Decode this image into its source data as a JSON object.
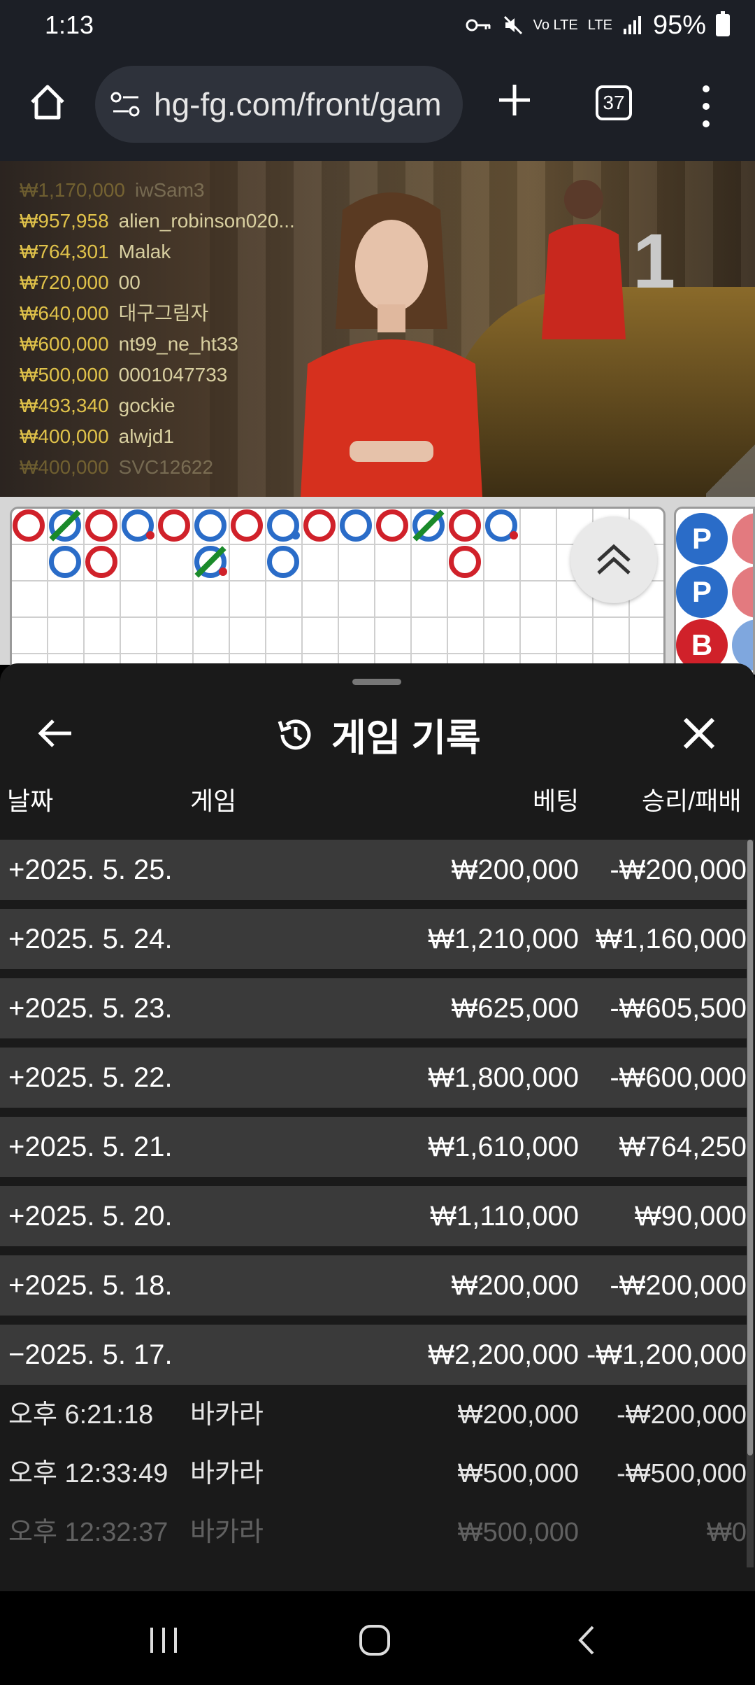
{
  "status_bar": {
    "time": "1:13",
    "network": "LTE",
    "volte": "Vo LTE",
    "battery": "95%"
  },
  "browser": {
    "url": "hg-fg.com/front/gam",
    "tab_count": "37"
  },
  "video": {
    "table_number": "1",
    "winners": [
      {
        "amount": "₩1,170,000",
        "name": "iwSam3"
      },
      {
        "amount": "₩957,958",
        "name": "alien_robinson020..."
      },
      {
        "amount": "₩764,301",
        "name": "Malak"
      },
      {
        "amount": "₩720,000",
        "name": "00"
      },
      {
        "amount": "₩640,000",
        "name": "대구그림자"
      },
      {
        "amount": "₩600,000",
        "name": "nt99_ne_ht33"
      },
      {
        "amount": "₩500,000",
        "name": "0001047733"
      },
      {
        "amount": "₩493,340",
        "name": "gockie"
      },
      {
        "amount": "₩400,000",
        "name": "alwjd1"
      },
      {
        "amount": "₩400,000",
        "name": "SVC12622"
      }
    ]
  },
  "side_road": [
    "P",
    "P",
    "B"
  ],
  "sheet": {
    "title": "게임 기록",
    "columns": {
      "date": "날짜",
      "game": "게임",
      "bet": "베팅",
      "win_loss": "승리/패배"
    },
    "days": [
      {
        "date": "+2025. 5. 25.",
        "bet": "₩200,000",
        "win_loss": "-₩200,000"
      },
      {
        "date": "+2025. 5. 24.",
        "bet": "₩1,210,000",
        "win_loss": "₩1,160,000"
      },
      {
        "date": "+2025. 5. 23.",
        "bet": "₩625,000",
        "win_loss": "-₩605,500"
      },
      {
        "date": "+2025. 5. 22.",
        "bet": "₩1,800,000",
        "win_loss": "-₩600,000"
      },
      {
        "date": "+2025. 5. 21.",
        "bet": "₩1,610,000",
        "win_loss": "₩764,250"
      },
      {
        "date": "+2025. 5. 20.",
        "bet": "₩1,110,000",
        "win_loss": "₩90,000"
      },
      {
        "date": "+2025. 5. 18.",
        "bet": "₩200,000",
        "win_loss": "-₩200,000"
      },
      {
        "date": "−2025. 5. 17.",
        "bet": "₩2,200,000",
        "win_loss": "-₩1,200,000"
      }
    ],
    "details": [
      {
        "time": "오후 6:21:18",
        "game": "바카라",
        "bet": "₩200,000",
        "win_loss": "-₩200,000"
      },
      {
        "time": "오후 12:33:49",
        "game": "바카라",
        "bet": "₩500,000",
        "win_loss": "-₩500,000"
      },
      {
        "time": "오후 12:32:37",
        "game": "바카라",
        "bet": "₩500,000",
        "win_loss": "₩0"
      }
    ]
  },
  "colors": {
    "banker": "#d0212a",
    "player": "#2a6cc8",
    "tie": "#1a8a2a",
    "row_bg": "#3a3a3a",
    "sheet_bg": "#1a1a1a"
  }
}
